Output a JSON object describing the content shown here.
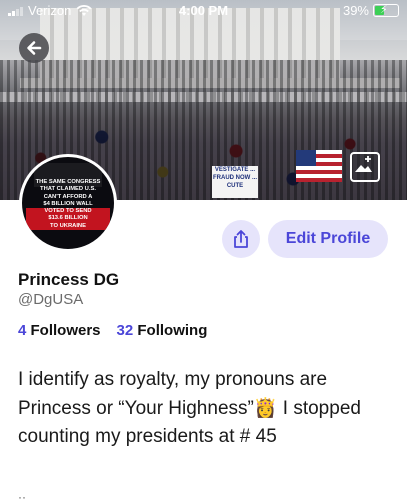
{
  "status_bar": {
    "carrier": "Verizon",
    "time": "4:00 PM",
    "battery_percent": "39%",
    "battery_level": 0.39,
    "battery_charging": true
  },
  "header": {
    "back_icon": "arrow-left-icon",
    "edit_banner_icon": "image-plus-icon",
    "banner_sign_text": "VESTIGATE ... FRAUD NOW ... CUTE"
  },
  "avatar": {
    "lines": [
      "THE SAME CONGRESS",
      "THAT CLAIMED U.S.",
      "CAN'T AFFORD A",
      "$4 BILLION WALL"
    ],
    "highlighted_lines": [
      "VOTED TO SEND",
      "$13.6 BILLION",
      "TO UKRAINE"
    ]
  },
  "actions": {
    "share_icon": "share-icon",
    "edit_profile_label": "Edit Profile"
  },
  "profile": {
    "display_name": "Princess DG",
    "handle": "@DgUSA",
    "followers_count": "4",
    "followers_label": "Followers",
    "following_count": "32",
    "following_label": "Following",
    "bio": "I identify as royalty, my pronouns are Princess or “Your Highness”👸 I stopped counting my presidents at # 45"
  },
  "colors": {
    "accent": "#4b46d8",
    "button_bg": "#e6e4fb",
    "text": "#111111",
    "muted": "#6b6b6b"
  }
}
